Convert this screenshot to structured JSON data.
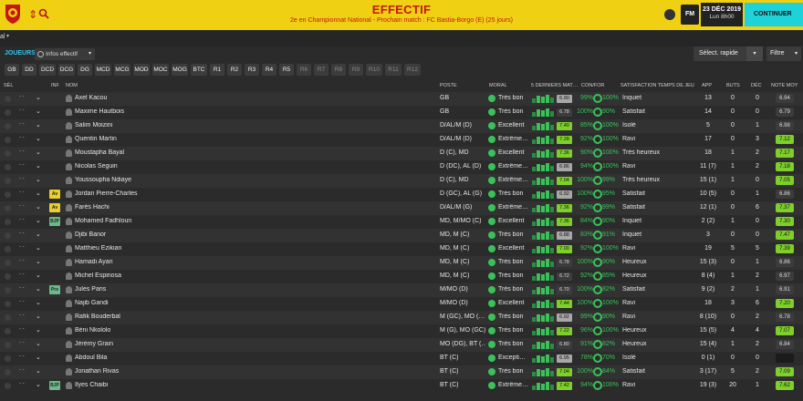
{
  "header": {
    "title": "EFFECTIF",
    "subtitle": "2e en Championnat National - Prochain match : FC Bastia-Borgo (E) (25 jours)",
    "date": "23 DÉC 2019",
    "day_time": "Lun 8h00",
    "fm_label": "FM",
    "continue_label": "CONTINUER",
    "accent": "#f0d012",
    "title_color": "#c4161c"
  },
  "filter_row": {
    "label": "al"
  },
  "toolbar": {
    "section_label": "JOUEURS",
    "view_label": "Infos effectif",
    "quick_select_label": "Sélect. rapide",
    "filter_label": "Filtre"
  },
  "chips": [
    "GB",
    "DD",
    "DCD",
    "DCG",
    "DG",
    "MCD",
    "MCG",
    "MOD",
    "MOC",
    "MOG",
    "BTC",
    "R1",
    "R2",
    "R3",
    "R4",
    "R5",
    "R6",
    "R7",
    "R8",
    "R9",
    "R10",
    "R11",
    "R12"
  ],
  "columns": {
    "sel": "SÉL",
    "inf": "INF",
    "nom": "NOM",
    "poste": "POSTE",
    "moral": "MORAL",
    "derniers_matchs": "5 DERNIERS MAT…",
    "con_for": "CON/FOR",
    "satisfaction": "SATISFACTION TEMPS DE JEU",
    "app": "APP",
    "buts": "BUTS",
    "dec": "DÉC",
    "note_moy": "NOTE MOY"
  },
  "players": [
    {
      "inf": "",
      "name": "Axel Kacou",
      "poste": "GB",
      "moral": "Très bon",
      "note5": "6.90",
      "con": "99%",
      "for": "100%",
      "satisfaction": "Inquiet",
      "app": "13",
      "buts": "0",
      "dec": "0",
      "note": "6.94",
      "note_style": "grey"
    },
    {
      "inf": "",
      "name": "Maxime Hautbois",
      "poste": "GB",
      "moral": "Très bon",
      "note5": "6.78",
      "con": "100%",
      "for": "90%",
      "satisfaction": "Satisfait",
      "app": "14",
      "buts": "0",
      "dec": "0",
      "note": "6.79",
      "note_style": "grey"
    },
    {
      "inf": "",
      "name": "Salim Moizini",
      "poste": "D/AL/M (D)",
      "moral": "Excellent",
      "note5": "7.40",
      "con": "85%",
      "for": "100%",
      "satisfaction": "Isolé",
      "app": "5",
      "buts": "0",
      "dec": "1",
      "note": "6.98",
      "note_style": "grey"
    },
    {
      "inf": "",
      "name": "Quentin Martin",
      "poste": "D/AL/M (D)",
      "moral": "Extrême…",
      "note5": "7.28",
      "con": "92%",
      "for": "100%",
      "satisfaction": "Ravi",
      "app": "17",
      "buts": "0",
      "dec": "3",
      "note": "7.12",
      "note_style": "green"
    },
    {
      "inf": "",
      "name": "Moustapha Bayal",
      "poste": "D (C), MD",
      "moral": "Excellent",
      "note5": "7.36",
      "con": "90%",
      "for": "100%",
      "satisfaction": "Très heureux",
      "app": "18",
      "buts": "1",
      "dec": "2",
      "note": "7.17",
      "note_style": "green"
    },
    {
      "inf": "",
      "name": "Nicolas Seguin",
      "poste": "D (DC), AL (D)",
      "moral": "Extrême…",
      "note5": "6.86",
      "con": "94%",
      "for": "100%",
      "satisfaction": "Ravi",
      "app": "11 (7)",
      "buts": "1",
      "dec": "2",
      "note": "7.18",
      "note_style": "green"
    },
    {
      "inf": "",
      "name": "Youssoupha Ndiaye",
      "poste": "D (C), MD",
      "moral": "Extrême…",
      "note5": "7.04",
      "con": "100%",
      "for": "99%",
      "satisfaction": "Très heureux",
      "app": "15 (1)",
      "buts": "1",
      "dec": "0",
      "note": "7.05",
      "note_style": "green"
    },
    {
      "inf": "Av",
      "name": "Jordan Pierre-Charles",
      "poste": "D (GC), AL (G)",
      "moral": "Très bon",
      "note5": "6.92",
      "con": "100%",
      "for": "95%",
      "satisfaction": "Satisfait",
      "app": "10 (5)",
      "buts": "0",
      "dec": "1",
      "note": "6.86",
      "note_style": "grey"
    },
    {
      "inf": "Av",
      "name": "Farès Hachi",
      "poste": "D/AL/M (G)",
      "moral": "Extrême…",
      "note5": "7.36",
      "con": "92%",
      "for": "99%",
      "satisfaction": "Satisfait",
      "app": "12 (1)",
      "buts": "0",
      "dec": "6",
      "note": "7.37",
      "note_style": "green"
    },
    {
      "inf": "BJP",
      "name": "Mohamed Fadhloun",
      "poste": "MD, M/MO (C)",
      "moral": "Excellent",
      "note5": "7.36",
      "con": "84%",
      "for": "90%",
      "satisfaction": "Inquiet",
      "app": "2 (2)",
      "buts": "1",
      "dec": "0",
      "note": "7.30",
      "note_style": "green"
    },
    {
      "inf": "",
      "name": "Djibi Banor",
      "poste": "MD, M (C)",
      "moral": "Très bon",
      "note5": "6.88",
      "con": "83%",
      "for": "91%",
      "satisfaction": "Inquiet",
      "app": "3",
      "buts": "0",
      "dec": "0",
      "note": "7.47",
      "note_style": "green"
    },
    {
      "inf": "",
      "name": "Matthieu Ezikian",
      "poste": "MD, M (C)",
      "moral": "Excellent",
      "note5": "7.00",
      "con": "92%",
      "for": "100%",
      "satisfaction": "Ravi",
      "app": "19",
      "buts": "5",
      "dec": "5",
      "note": "7.39",
      "note_style": "green"
    },
    {
      "inf": "",
      "name": "Hamadi Ayari",
      "poste": "MD, M (C)",
      "moral": "Très bon",
      "note5": "6.78",
      "con": "100%",
      "for": "90%",
      "satisfaction": "Heureux",
      "app": "15 (3)",
      "buts": "0",
      "dec": "1",
      "note": "6.86",
      "note_style": "grey"
    },
    {
      "inf": "",
      "name": "Michel Espinosa",
      "poste": "MD, M (C)",
      "moral": "Très bon",
      "note5": "6.72",
      "con": "92%",
      "for": "85%",
      "satisfaction": "Heureux",
      "app": "8 (4)",
      "buts": "1",
      "dec": "2",
      "note": "6.97",
      "note_style": "grey"
    },
    {
      "inf": "Pre",
      "name": "Jules Paris",
      "poste": "M/MO (D)",
      "moral": "Très bon",
      "note5": "6.70",
      "con": "100%",
      "for": "82%",
      "satisfaction": "Satisfait",
      "app": "9 (2)",
      "buts": "2",
      "dec": "1",
      "note": "6.91",
      "note_style": "grey"
    },
    {
      "inf": "",
      "name": "Najib Gandi",
      "poste": "M/MO (D)",
      "moral": "Excellent",
      "note5": "7.44",
      "con": "100%",
      "for": "100%",
      "satisfaction": "Ravi",
      "app": "18",
      "buts": "3",
      "dec": "6",
      "note": "7.20",
      "note_style": "green"
    },
    {
      "inf": "",
      "name": "Rafik Bouderbal",
      "poste": "M (GC), MO (…",
      "moral": "Très bon",
      "note5": "6.92",
      "con": "99%",
      "for": "90%",
      "satisfaction": "Ravi",
      "app": "8 (10)",
      "buts": "0",
      "dec": "2",
      "note": "6.78",
      "note_style": "grey"
    },
    {
      "inf": "",
      "name": "Béni Nkololo",
      "poste": "M (G), MO (GC)",
      "moral": "Très bon",
      "note5": "7.22",
      "con": "96%",
      "for": "100%",
      "satisfaction": "Heureux",
      "app": "15 (5)",
      "buts": "4",
      "dec": "4",
      "note": "7.07",
      "note_style": "green"
    },
    {
      "inf": "",
      "name": "Jérémy Grain",
      "poste": "MO (DG), BT (…",
      "moral": "Très bon",
      "note5": "6.80",
      "con": "91%",
      "for": "82%",
      "satisfaction": "Heureux",
      "app": "15 (4)",
      "buts": "1",
      "dec": "2",
      "note": "6.84",
      "note_style": "grey"
    },
    {
      "inf": "",
      "name": "Abdoul Bila",
      "poste": "BT (C)",
      "moral": "Excepti…",
      "note5": "6.95",
      "con": "78%",
      "for": "70%",
      "satisfaction": "Isolé",
      "app": "0 (1)",
      "buts": "0",
      "dec": "0",
      "note": "",
      "note_style": "dark"
    },
    {
      "inf": "",
      "name": "Jonathan Rivas",
      "poste": "BT (C)",
      "moral": "Très bon",
      "note5": "7.04",
      "con": "100%",
      "for": "84%",
      "satisfaction": "Satisfait",
      "app": "3 (17)",
      "buts": "5",
      "dec": "2",
      "note": "7.09",
      "note_style": "green"
    },
    {
      "inf": "BJP",
      "name": "Ilyes Chaibi",
      "poste": "BT (C)",
      "moral": "Extrême…",
      "note5": "7.42",
      "con": "94%",
      "for": "100%",
      "satisfaction": "Ravi",
      "app": "19 (3)",
      "buts": "20",
      "dec": "1",
      "note": "7.62",
      "note_style": "green"
    }
  ]
}
